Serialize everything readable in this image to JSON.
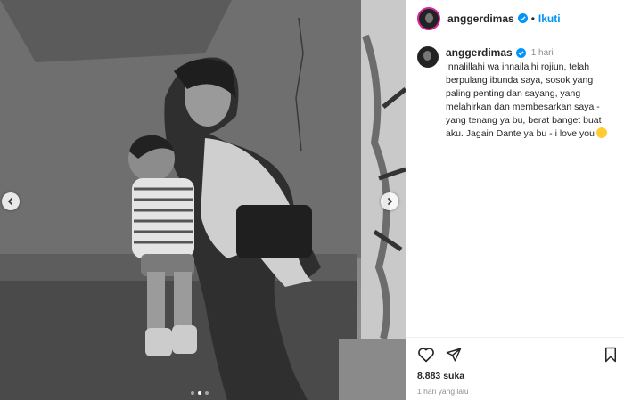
{
  "post": {
    "username": "anggerdimas",
    "follow_label": "Ikuti",
    "separator": "•",
    "caption_username": "anggerdimas",
    "caption_time": "1 hari",
    "caption_text": "Innalillahi wa innailaihi rojiun, telah berpulang ibunda saya, sosok yang paling penting dan sayang, yang melahirkan dan membesarkan saya - yang tenang ya bu, berat banget buat aku. Jagain Dante ya bu - i love you",
    "likes": "8.883 suka",
    "posted_ago": "1 hari yang lalu"
  },
  "icons": [
    "heart-icon",
    "share-icon",
    "bookmark-icon",
    "verified-icon",
    "chevron-left-icon",
    "chevron-right-icon",
    "smile-emoji"
  ],
  "colors": {
    "accent": "#0095f6",
    "verified": "#0095f6",
    "text": "#262626",
    "muted": "#8e8e8e"
  }
}
